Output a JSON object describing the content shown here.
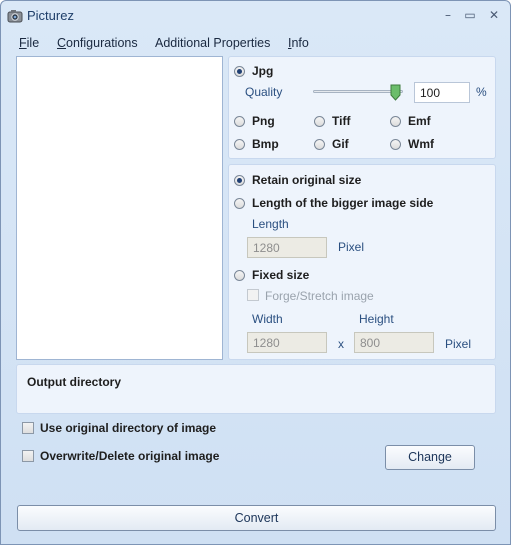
{
  "window": {
    "title": "Picturez"
  },
  "titlebar": {
    "minimize": "–",
    "maximize": "▭",
    "close": "✕"
  },
  "menu": {
    "file": {
      "accel": "F",
      "rest": "ile"
    },
    "configurations": {
      "accel": "C",
      "rest": "onfigurations"
    },
    "additional": "Additional Properties",
    "info": {
      "accel": "I",
      "rest": "nfo"
    }
  },
  "format": {
    "jpg": "Jpg",
    "quality_label": "Quality",
    "quality_value": "100",
    "quality_level": 1.0,
    "percent": "%",
    "png": "Png",
    "tiff": "Tiff",
    "emf": "Emf",
    "bmp": "Bmp",
    "gif": "Gif",
    "wmf": "Wmf",
    "selected": "Jpg"
  },
  "size": {
    "retain": "Retain original size",
    "bigger_side": "Length of the bigger image side",
    "length_label": "Length",
    "length_value": "1280",
    "pixel1": "Pixel",
    "fixed": "Fixed size",
    "forge": "Forge/Stretch image",
    "width_label": "Width",
    "height_label": "Height",
    "width_value": "1280",
    "x": "x",
    "height_value": "800",
    "pixel2": "Pixel",
    "selected": "Retain original size"
  },
  "output": {
    "title": "Output directory",
    "use_original": "Use original directory of image",
    "overwrite": "Overwrite/Delete original image",
    "change": "Change"
  },
  "convert": "Convert",
  "colors": {
    "accent": "#1f3f73",
    "panel": "#eef4fc",
    "window": "#d6e5f5"
  }
}
